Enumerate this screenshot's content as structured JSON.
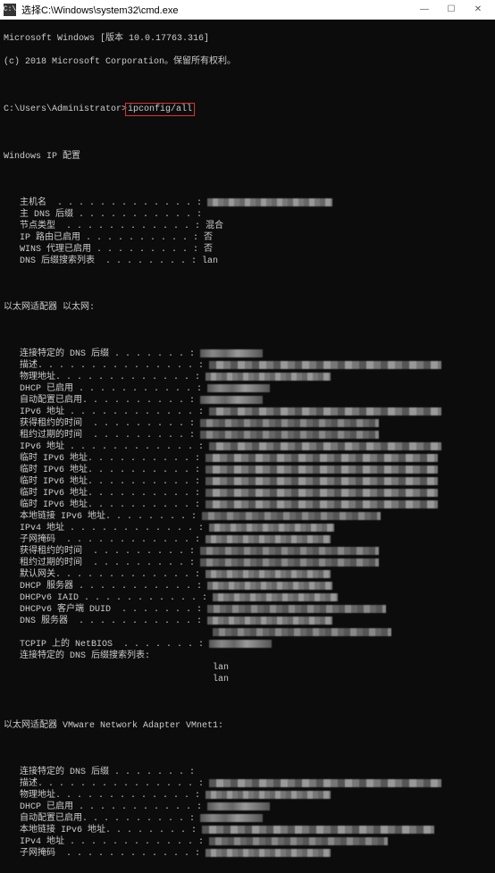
{
  "titlebar": {
    "icon_label": "C:\\",
    "title": "选择C:\\Windows\\system32\\cmd.exe",
    "min": "—",
    "max": "☐",
    "close": "✕"
  },
  "header": {
    "line1": "Microsoft Windows [版本 10.0.17763.316]",
    "line2": "(c) 2018 Microsoft Corporation。保留所有权利。",
    "prompt": "C:\\Users\\Administrator>",
    "command": "ipconfig/all"
  },
  "section_ip": {
    "title": "Windows IP 配置",
    "rows": [
      {
        "label": "   主机名  . . . . . . . . . . . . . :",
        "mosaic": "md"
      },
      {
        "label": "   主 DNS 后缀 . . . . . . . . . . . :",
        "value": ""
      },
      {
        "label": "   节点类型  . . . . . . . . . . . . :",
        "value": " 混合"
      },
      {
        "label": "   IP 路由已启用 . . . . . . . . . . :",
        "value": " 否"
      },
      {
        "label": "   WINS 代理已启用 . . . . . . . . . :",
        "value": " 否"
      },
      {
        "label": "   DNS 后缀搜索列表  . . . . . . . . :",
        "value": " lan"
      }
    ]
  },
  "section_eth": {
    "title": "以太网适配器 以太网:",
    "rows": [
      {
        "label": "   连接特定的 DNS 后缀 . . . . . . . :",
        "mosaic": "sm"
      },
      {
        "label": "   描述. . . . . . . . . . . . . . . :",
        "mosaic": "xl"
      },
      {
        "label": "   物理地址. . . . . . . . . . . . . :",
        "mosaic": "md"
      },
      {
        "label": "   DHCP 已启用 . . . . . . . . . . . :",
        "mosaic": "sm"
      },
      {
        "label": "   自动配置已启用. . . . . . . . . . :",
        "mosaic": "sm"
      },
      {
        "label": "   IPv6 地址 . . . . . . . . . . . . :",
        "mosaic": "xl"
      },
      {
        "label": "   获得租约的时间  . . . . . . . . . :",
        "mosaic": "lg"
      },
      {
        "label": "   租约过期的时间  . . . . . . . . . :",
        "mosaic": "lg"
      },
      {
        "label": "   IPv6 地址 . . . . . . . . . . . . :",
        "mosaic": "xl"
      },
      {
        "label": "   临时 IPv6 地址. . . . . . . . . . :",
        "mosaic": "xl"
      },
      {
        "label": "   临时 IPv6 地址. . . . . . . . . . :",
        "mosaic": "xl"
      },
      {
        "label": "   临时 IPv6 地址. . . . . . . . . . :",
        "mosaic": "xl"
      },
      {
        "label": "   临时 IPv6 地址. . . . . . . . . . :",
        "mosaic": "xl"
      },
      {
        "label": "   临时 IPv6 地址. . . . . . . . . . :",
        "mosaic": "xl"
      },
      {
        "label": "   本地链接 IPv6 地址. . . . . . . . :",
        "mosaic": "lg"
      },
      {
        "label": "   IPv4 地址 . . . . . . . . . . . . :",
        "mosaic": "md"
      },
      {
        "label": "   子网掩码  . . . . . . . . . . . . :",
        "mosaic": "md"
      },
      {
        "label": "   获得租约的时间  . . . . . . . . . :",
        "mosaic": "lg"
      },
      {
        "label": "   租约过期的时间  . . . . . . . . . :",
        "mosaic": "lg"
      },
      {
        "label": "   默认网关. . . . . . . . . . . . . :",
        "mosaic": "md"
      },
      {
        "label": "   DHCP 服务器 . . . . . . . . . . . :",
        "mosaic": "md"
      },
      {
        "label": "   DHCPv6 IAID . . . . . . . . . . . :",
        "mosaic": "md"
      },
      {
        "label": "   DHCPv6 客户端 DUID  . . . . . . . :",
        "mosaic": "lg"
      },
      {
        "label": "   DNS 服务器  . . . . . . . . . . . :",
        "mosaic": "md"
      },
      {
        "label": "                                      ",
        "mosaic": "lg"
      },
      {
        "label": "   TCPIP 上的 NetBIOS  . . . . . . . :",
        "mosaic": "sm"
      },
      {
        "label": "   连接特定的 DNS 后缀搜索列表:",
        "value": ""
      },
      {
        "label": "                                      ",
        "value": " lan"
      },
      {
        "label": "                                      ",
        "value": " lan"
      }
    ]
  },
  "section_vm": {
    "title": "以太网适配器 VMware Network Adapter VMnet1:",
    "rows": [
      {
        "label": "   连接特定的 DNS 后缀 . . . . . . . :",
        "value": ""
      },
      {
        "label": "   描述. . . . . . . . . . . . . . . :",
        "mosaic": "xl"
      },
      {
        "label": "   物理地址. . . . . . . . . . . . . :",
        "mosaic": "md"
      },
      {
        "label": "   DHCP 已启用 . . . . . . . . . . . :",
        "mosaic": "sm"
      },
      {
        "label": "   自动配置已启用. . . . . . . . . . :",
        "mosaic": "sm"
      },
      {
        "label": "   本地链接 IPv6 地址. . . . . . . . :",
        "mosaic": "xl"
      },
      {
        "label": "   IPv4 地址 . . . . . . . . . . . . :",
        "mosaic": "lg"
      },
      {
        "label": "   子网掩码  . . . . . . . . . . . . :",
        "mosaic": "md"
      }
    ]
  }
}
